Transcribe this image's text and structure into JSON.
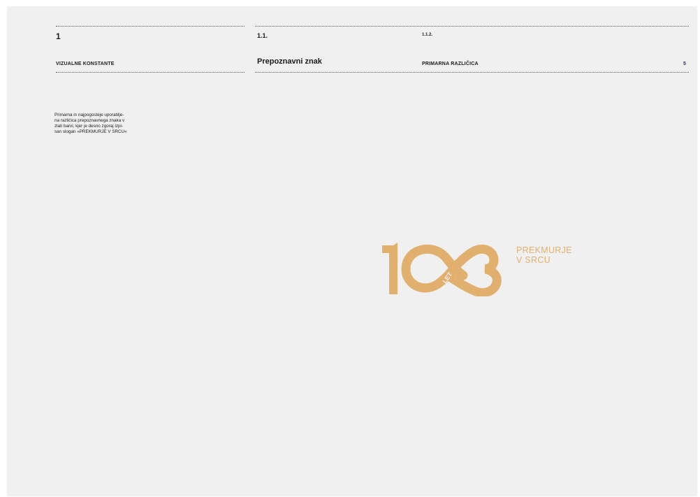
{
  "header": {
    "chapter_number": "1",
    "chapter_title": "VIZUALNE KONSTANTE",
    "section_number": "1.1.",
    "section_title": "Prepoznavni znak",
    "subsection_number": "1.1.2.",
    "subsection_title": "PRIMARNA RAZLIČICA",
    "page_number": "5"
  },
  "description": "Primarna in najpogosteje uporablje-\nna različica prepoznavnega znaka v\nzlati barvi, kjer je desno zgoraj izpi-\nsan slogan »PREKMURJE V SRCU«",
  "logo": {
    "mark_text": "LET",
    "slogan_line1": "PREKMURJE",
    "slogan_line2": "V SRCU",
    "color": "#e2b06e"
  }
}
